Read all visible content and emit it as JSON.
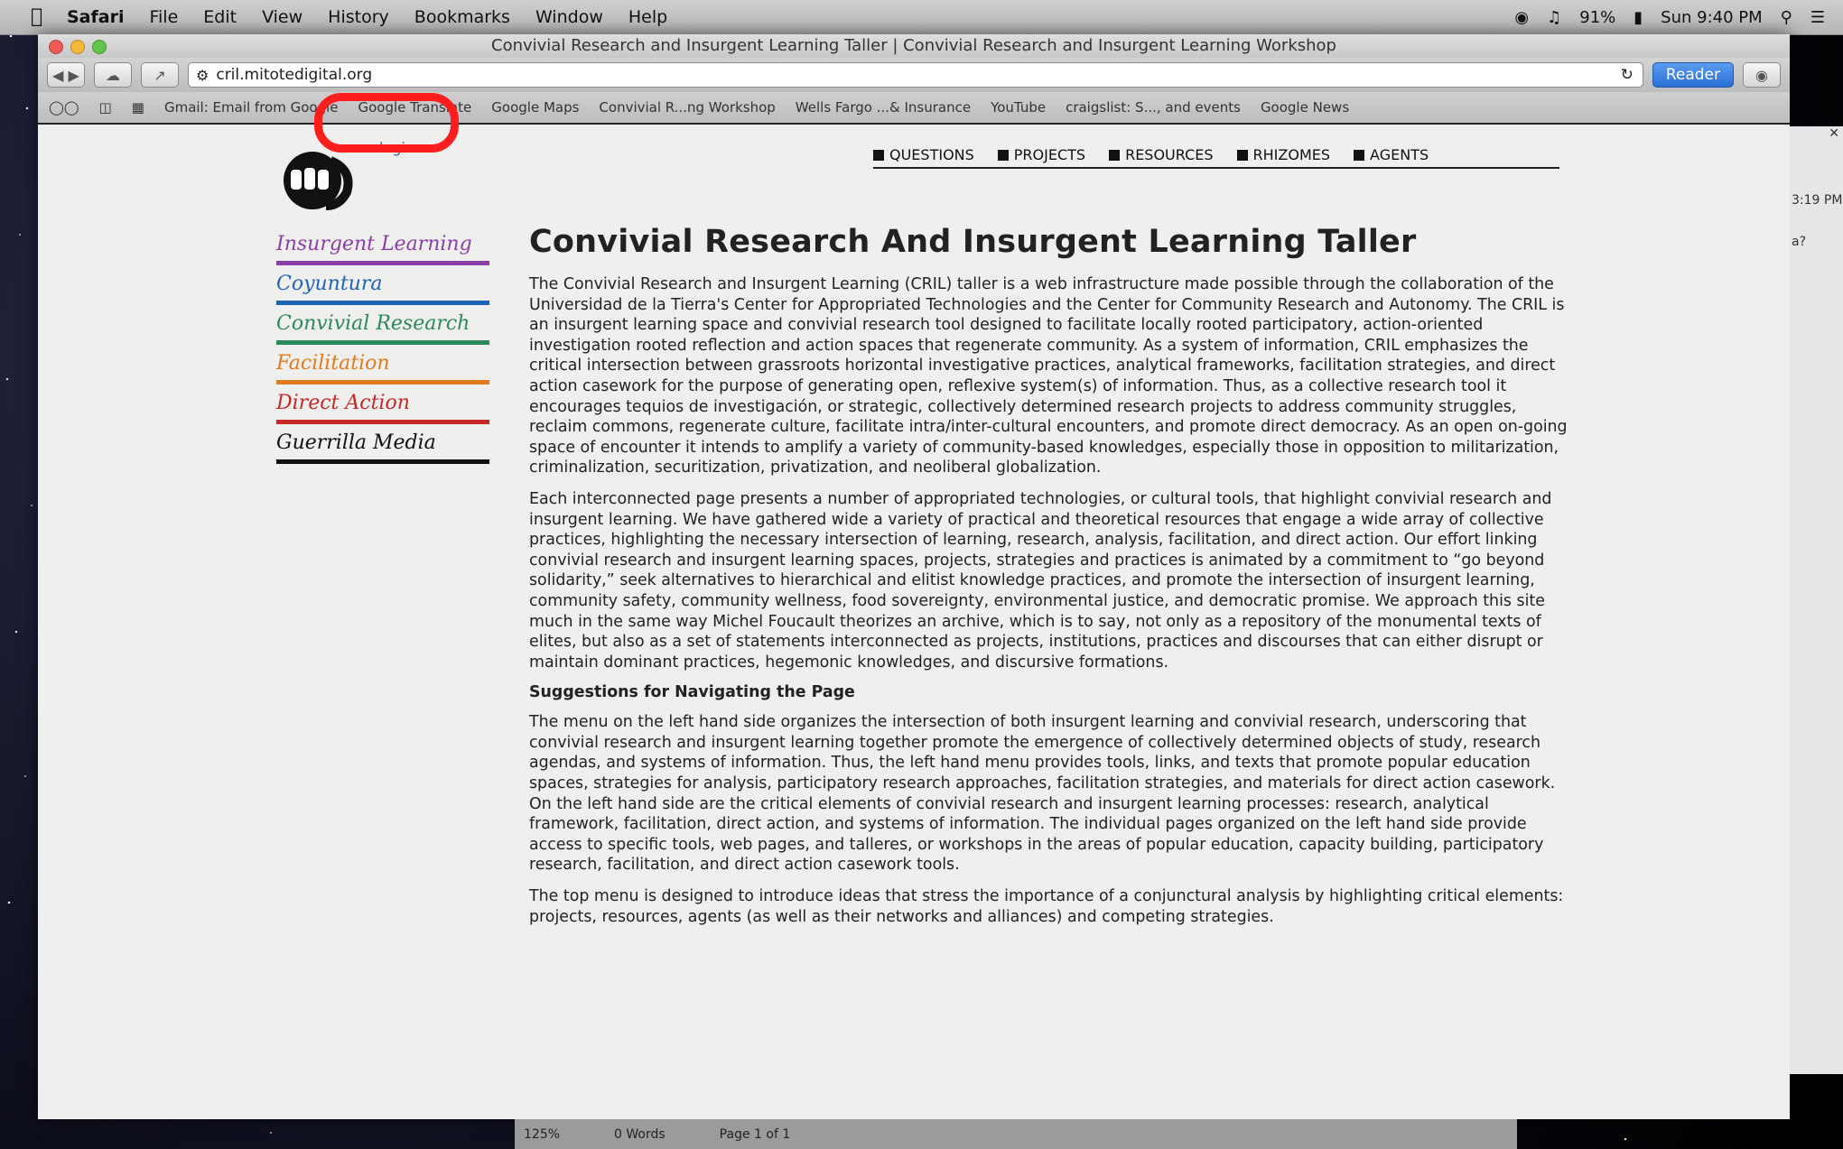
{
  "menubar": {
    "app": "Safari",
    "items": [
      "File",
      "Edit",
      "View",
      "History",
      "Bookmarks",
      "Window",
      "Help"
    ],
    "battery": "91%",
    "clock": "Sun 9:40 PM"
  },
  "window": {
    "title": "Convivial Research and Insurgent Learning Taller | Convivial Research and Insurgent Learning Workshop",
    "url": "cril.mitotedigital.org",
    "reader": "Reader"
  },
  "bookmarks": [
    "Gmail: Email from Google",
    "Google Translate",
    "Google Maps",
    "Convivial R...ng Workshop",
    "Wells Fargo ...& Insurance",
    "YouTube",
    "craigslist: S..., and events",
    "Google News"
  ],
  "page": {
    "login": "login",
    "topnav": [
      "QUESTIONS",
      "PROJECTS",
      "RESOURCES",
      "RHIZOMES",
      "AGENTS"
    ],
    "sidemenu": [
      {
        "label": "Insurgent Learning",
        "color": "#8a3fa8"
      },
      {
        "label": "Coyuntura",
        "color": "#1f63b5"
      },
      {
        "label": "Convivial Research",
        "color": "#2c8a5a"
      },
      {
        "label": "Facilitation",
        "color": "#e07b1f"
      },
      {
        "label": "Direct Action",
        "color": "#c62828"
      },
      {
        "label": "Guerrilla Media",
        "color": "#111111"
      }
    ],
    "title": "Convivial Research And Insurgent Learning Taller",
    "p1": "The Convivial Research and Insurgent Learning (CRIL) taller is a web infrastructure made possible through the collaboration of the Universidad de la Tierra's Center for Appropriated Technologies and the Center for Community Research and Autonomy. The CRIL is an insurgent learning space and convivial research tool designed to facilitate locally rooted participatory, action-oriented investigation rooted reflection and action spaces that regenerate community. As a system of information, CRIL emphasizes the critical intersection between grassroots horizontal investigative practices, analytical frameworks, facilitation strategies, and direct action casework for the purpose of generating open, reflexive system(s) of information. Thus, as a collective research tool it encourages tequios de investigación, or strategic, collectively determined research projects to address community struggles, reclaim commons, regenerate culture, facilitate intra/inter-cultural encounters, and promote direct democracy. As an open on-going space of encounter it intends to amplify a variety of community-based knowledges, especially those in opposition to militarization, criminalization, securitization, privatization, and neoliberal globalization.",
    "p2": "Each interconnected page presents a number of appropriated technologies, or cultural tools, that highlight convivial research and insurgent learning. We have gathered wide a variety of practical and theoretical resources that engage a wide array of collective practices, highlighting the necessary intersection of learning, research, analysis, facilitation, and direct action. Our effort linking convivial research and insurgent learning spaces, projects, strategies and practices is animated by a commitment to “go beyond solidarity,” seek alternatives to hierarchical and elitist knowledge practices, and promote the intersection of insurgent learning, community safety, community wellness, food sovereignty, environmental justice, and democratic promise. We approach this site much in the same way Michel Foucault theorizes an archive, which is to say, not only as a repository of the monumental texts of elites, but also as a set of statements interconnected as projects, institutions, practices and discourses that can either disrupt or maintain dominant practices, hegemonic knowledges, and discursive formations.",
    "subhead": "Suggestions for Navigating the Page",
    "p3": "The menu on the left hand side organizes the intersection of both insurgent learning and convivial research, underscoring that convivial research and insurgent learning together promote the emergence of collectively determined objects of study, research agendas, and systems of information. Thus, the left hand menu provides tools, links, and texts that promote popular education spaces, strategies for analysis, participatory research approaches, facilitation strategies, and materials for direct action casework. On the left hand side are the critical elements of convivial research and insurgent learning processes: research, analytical framework, facilitation, direct action, and systems of information. The individual pages organized on the left hand side provide access to specific tools, web pages, and talleres, or workshops in the areas of popular education, capacity building, participatory research, facilitation, and direct action casework tools.",
    "p4": "The top menu is designed to introduce ideas that stress the importance of a conjunctural analysis by highlighting critical elements: projects, resources, agents (as well as their networks and alliances) and competing strategies."
  },
  "statusbar": {
    "zoom": "125%",
    "words": "0 Words",
    "page": "Page 1 of 1"
  },
  "rightpanel": {
    "time": "3:19 PM",
    "q": "a?"
  }
}
